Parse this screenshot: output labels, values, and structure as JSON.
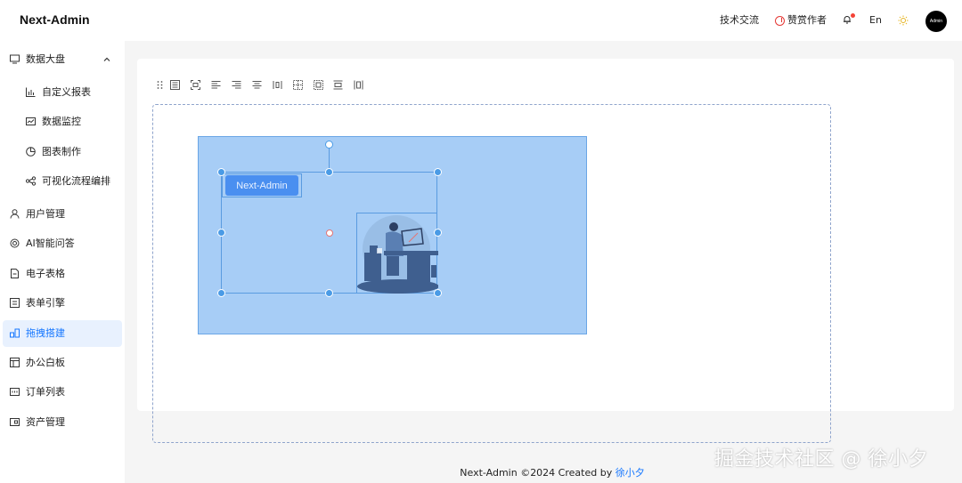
{
  "header": {
    "logo": "Next-Admin",
    "tech_exchange": "技术交流",
    "reward_author": "赞赏作者",
    "language": "En",
    "avatar_text": "Admin"
  },
  "sidebar": {
    "group_label": "数据大盘",
    "sub_items": [
      {
        "label": "自定义报表",
        "icon": "bar-chart-icon"
      },
      {
        "label": "数据监控",
        "icon": "monitor-line-icon"
      },
      {
        "label": "图表制作",
        "icon": "pie-chart-icon"
      },
      {
        "label": "可视化流程编排",
        "icon": "flow-icon"
      }
    ],
    "items": [
      {
        "label": "用户管理",
        "icon": "user-icon"
      },
      {
        "label": "AI智能问答",
        "icon": "ai-icon"
      },
      {
        "label": "电子表格",
        "icon": "file-icon"
      },
      {
        "label": "表单引擎",
        "icon": "form-icon"
      },
      {
        "label": "拖拽搭建",
        "icon": "drag-build-icon"
      },
      {
        "label": "办公白板",
        "icon": "whiteboard-icon"
      },
      {
        "label": "订单列表",
        "icon": "order-icon"
      },
      {
        "label": "资产管理",
        "icon": "asset-icon"
      }
    ],
    "active_label": "拖拽搭建",
    "accent_color": "#1677ff"
  },
  "editor": {
    "button_label": "Next-Admin",
    "toolbar_icons": [
      "drag-handle-icon",
      "align-top-icon",
      "align-center-icon",
      "align-left-icon",
      "align-right-icon",
      "align-middle-icon",
      "distribute-h-icon",
      "grid-icon",
      "group-icon",
      "align-bottom-icon",
      "distribute-v-icon"
    ]
  },
  "footer": {
    "text": "Next-Admin ©2024 Created by ",
    "author": "徐小夕"
  },
  "watermark": "掘金技术社区 @ 徐小夕"
}
